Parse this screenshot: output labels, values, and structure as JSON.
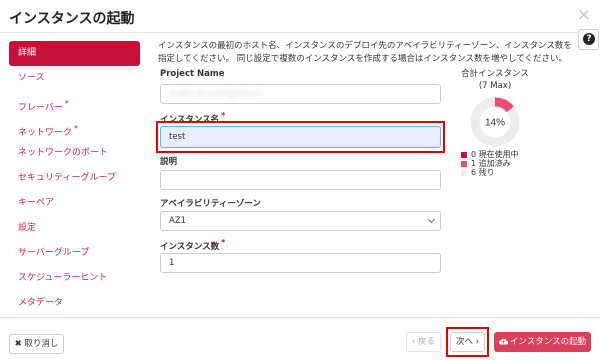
{
  "dialog": {
    "title": "インスタンスの起動",
    "close_glyph": "×",
    "help_glyph": "?"
  },
  "sidebar": {
    "items": [
      {
        "label": "詳細",
        "active": true,
        "required": false
      },
      {
        "label": "ソース",
        "active": false,
        "required": false
      },
      {
        "label": "フレーバー",
        "active": false,
        "required": true
      },
      {
        "label": "ネットワーク",
        "active": false,
        "required": true
      },
      {
        "label": "ネットワークのポート",
        "active": false,
        "required": false
      },
      {
        "label": "セキュリティーグループ",
        "active": false,
        "required": false
      },
      {
        "label": "キーペア",
        "active": false,
        "required": false
      },
      {
        "label": "設定",
        "active": false,
        "required": false
      },
      {
        "label": "サーバーグループ",
        "active": false,
        "required": false
      },
      {
        "label": "スケジューラーヒント",
        "active": false,
        "required": false
      },
      {
        "label": "メタデータ",
        "active": false,
        "required": false
      }
    ],
    "required_mark": "*"
  },
  "form": {
    "description": "インスタンスの最初のホスト名、インスタンスのデプロイ先のアベイラビリティーゾーン、インスタンス数を指定してください。 同じ設定で複数のインスタンスを作成する場合はインスタンス数を増やしてください。",
    "project_name_label": "Project Name",
    "project_name_value": "public-tn-tomigaihor1",
    "instance_name_label": "インスタンス名",
    "instance_name_value": "test",
    "description_label": "説明",
    "description_value": "",
    "az_label": "アベイラビリティーゾーン",
    "az_value": "AZ1",
    "count_label": "インスタンス数",
    "count_value": "1",
    "required_mark": "*"
  },
  "quota": {
    "title": "合計インスタンス",
    "max_label": "(7 Max)",
    "percent_label": "14%",
    "percent": 14,
    "legend": [
      {
        "count": "0",
        "label": "現在使用中",
        "color": "#c7113c"
      },
      {
        "count": "1",
        "label": "追加済み",
        "color": "#e94c74"
      },
      {
        "count": "6",
        "label": "残り",
        "color": "#eeeeee"
      }
    ],
    "colors": {
      "used": "#e94c74",
      "remaining": "#ededed"
    }
  },
  "footer": {
    "cancel_label": "✖ 取り消し",
    "back_label": "‹ 戻る",
    "next_label": "次へ ›",
    "launch_label": "インスタンスの起動",
    "launch_icon": "cloud-upload-icon"
  },
  "colors": {
    "accent": "#c7113c",
    "highlight": "#e00000",
    "primary_button": "#d9415a"
  }
}
